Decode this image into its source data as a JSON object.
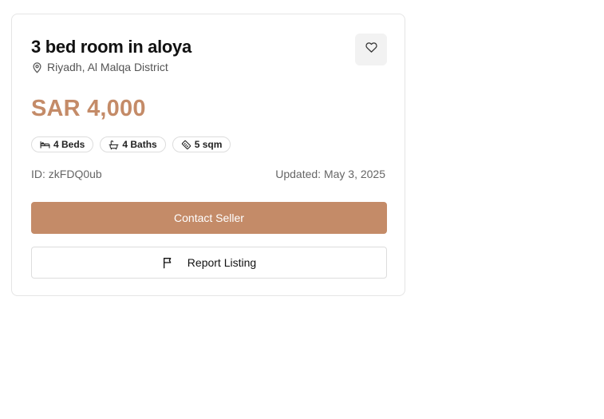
{
  "listing": {
    "title": "3 bed room in aloya",
    "location": "Riyadh, Al Malqa District",
    "price": "SAR 4,000",
    "features": {
      "beds": "4 Beds",
      "baths": "4 Baths",
      "area": "5 sqm"
    },
    "id_text": "ID: zkFDQ0ub",
    "updated_text": "Updated: May 3, 2025"
  },
  "actions": {
    "contact_label": "Contact Seller",
    "report_label": "Report Listing"
  },
  "icons": {
    "location": "map-pin-icon",
    "favorite": "heart-icon",
    "beds": "bed-icon",
    "baths": "bath-icon",
    "area": "ruler-icon",
    "report": "flag-icon"
  },
  "colors": {
    "accent": "#c48b68",
    "favorite_bg": "#f2f2f2",
    "border": "#e5e5e5"
  }
}
